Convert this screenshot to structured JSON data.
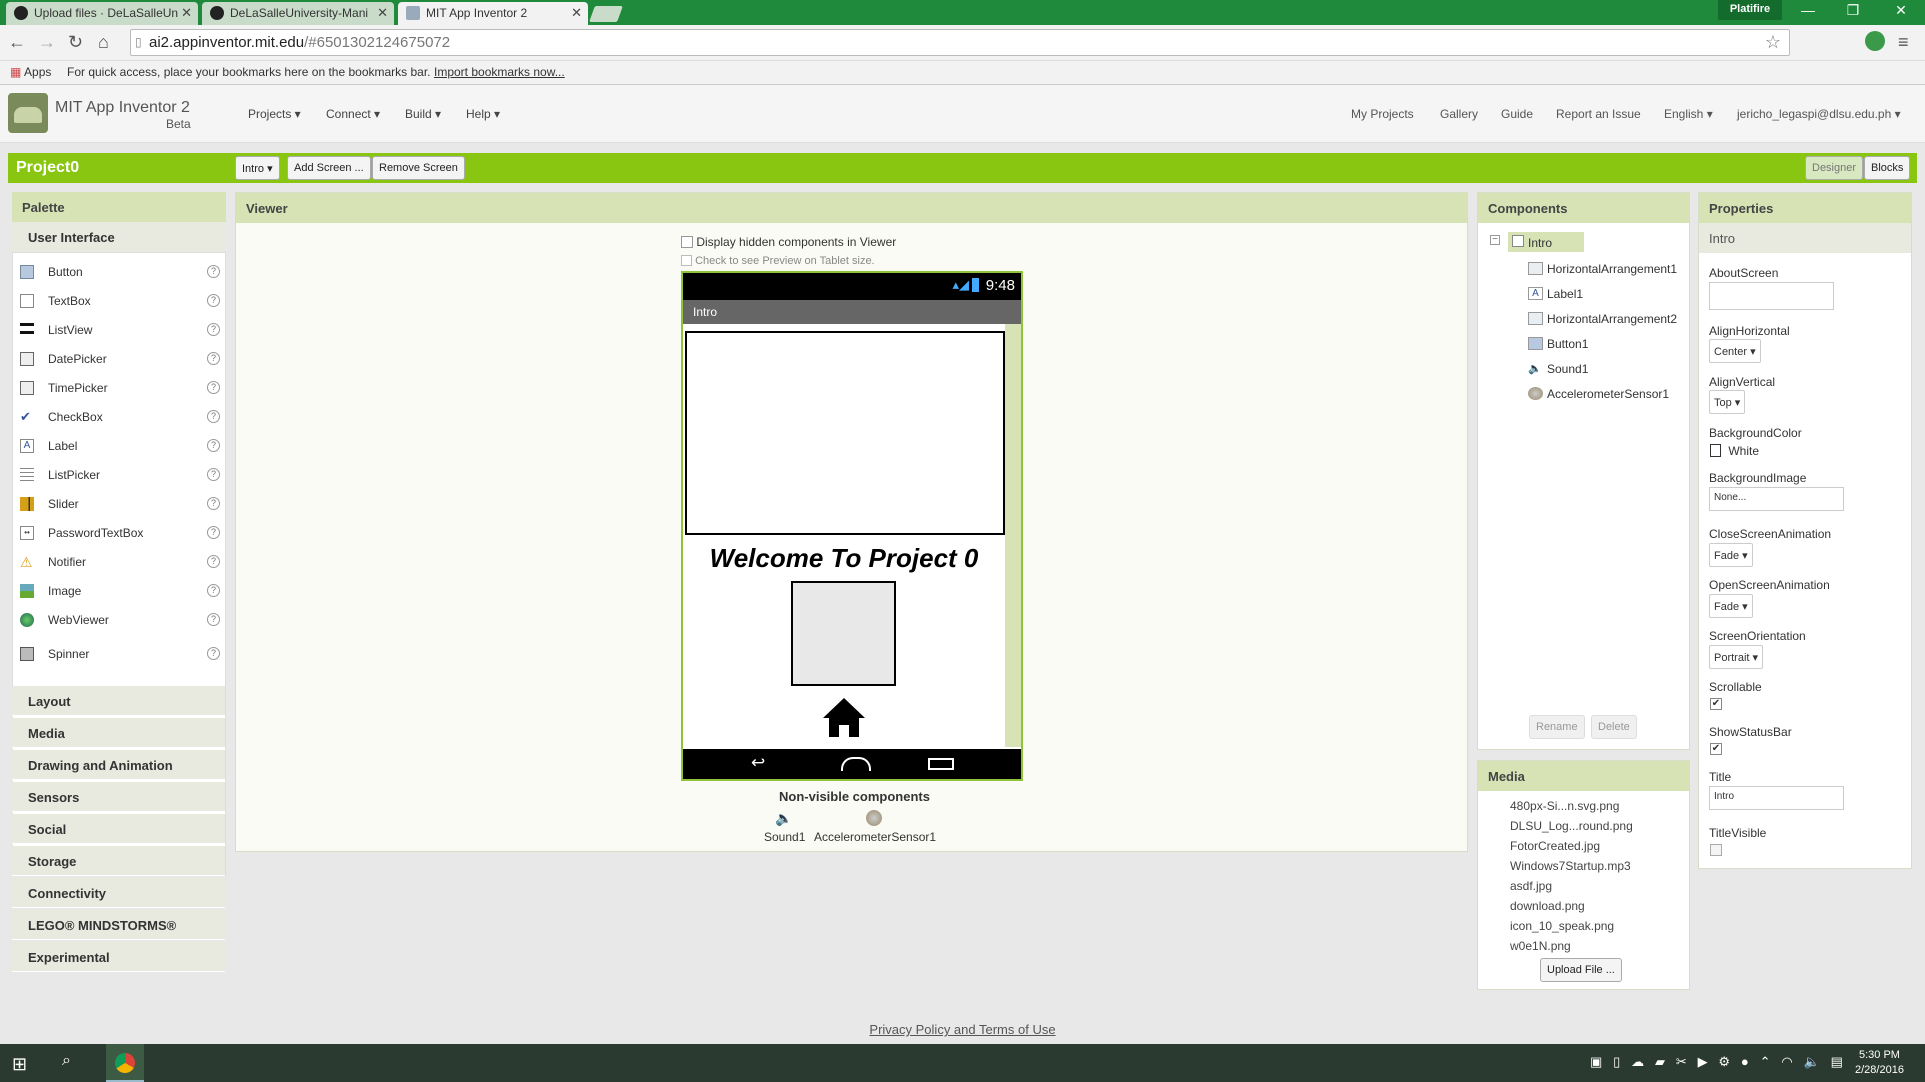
{
  "browser": {
    "tabs": [
      {
        "label": "Upload files · DeLaSalleUn",
        "active": false
      },
      {
        "label": "DeLaSalleUniversity-Mani",
        "active": false
      },
      {
        "label": "MIT App Inventor 2",
        "active": true
      }
    ],
    "profile": "Platifire",
    "url_host": "ai2.appinventor.mit.edu",
    "url_path": "/#6501302124675072",
    "bookmarks_apps": "Apps",
    "bookmarks_msg": "For quick access, place your bookmarks here on the bookmarks bar.",
    "bookmarks_import": "Import bookmarks now..."
  },
  "header": {
    "app_name": "MIT App Inventor 2",
    "beta": "Beta",
    "menus": [
      "Projects ▾",
      "Connect ▾",
      "Build ▾",
      "Help ▾"
    ],
    "links": [
      "My Projects",
      "Gallery",
      "Guide",
      "Report an Issue",
      "English ▾",
      "jericho_legaspi@dlsu.edu.ph ▾"
    ]
  },
  "toolbar": {
    "project": "Project0",
    "screen_select": "Intro ▾",
    "add_screen": "Add Screen ...",
    "remove_screen": "Remove Screen",
    "designer": "Designer",
    "blocks": "Blocks"
  },
  "palette": {
    "title": "Palette",
    "category": "User Interface",
    "items": [
      "Button",
      "TextBox",
      "ListView",
      "DatePicker",
      "TimePicker",
      "CheckBox",
      "Label",
      "ListPicker",
      "Slider",
      "PasswordTextBox",
      "Notifier",
      "Image",
      "WebViewer",
      "Spinner"
    ],
    "help": "?",
    "categories": [
      "Layout",
      "Media",
      "Drawing and Animation",
      "Sensors",
      "Social",
      "Storage",
      "Connectivity",
      "LEGO® MINDSTORMS®",
      "Experimental"
    ]
  },
  "viewer": {
    "title": "Viewer",
    "hidden_toggle": "Display hidden components in Viewer",
    "tablet_toggle": "Check to see Preview on Tablet size.",
    "clock": "9:48",
    "screen_title": "Intro",
    "welcome": "Welcome To Project 0",
    "nonvisible_title": "Non-visible components",
    "nonvisible": [
      "Sound1",
      "AccelerometerSensor1"
    ]
  },
  "components": {
    "title": "Components",
    "root": "Intro",
    "items": [
      "HorizontalArrangement1",
      "Label1",
      "HorizontalArrangement2",
      "Button1",
      "Sound1",
      "AccelerometerSensor1"
    ],
    "rename": "Rename",
    "delete": "Delete"
  },
  "media": {
    "title": "Media",
    "files": [
      "480px-Si...n.svg.png",
      "DLSU_Log...round.png",
      "FotorCreated.jpg",
      "Windows7Startup.mp3",
      "asdf.jpg",
      "download.png",
      "icon_10_speak.png",
      "w0e1N.png"
    ],
    "upload": "Upload File ..."
  },
  "properties": {
    "title": "Properties",
    "component": "Intro",
    "about_label": "AboutScreen",
    "about_value": "",
    "align_h_label": "AlignHorizontal",
    "align_h_value": "Center ▾",
    "align_v_label": "AlignVertical",
    "align_v_value": "Top ▾",
    "bg_color_label": "BackgroundColor",
    "bg_color_value": "White",
    "bg_image_label": "BackgroundImage",
    "bg_image_value": "None...",
    "close_anim_label": "CloseScreenAnimation",
    "close_anim_value": "Fade ▾",
    "open_anim_label": "OpenScreenAnimation",
    "open_anim_value": "Fade ▾",
    "orientation_label": "ScreenOrientation",
    "orientation_value": "Portrait ▾",
    "scrollable_label": "Scrollable",
    "scrollable": true,
    "statusbar_label": "ShowStatusBar",
    "statusbar": true,
    "title_label": "Title",
    "title_value": "Intro",
    "titlevisible_label": "TitleVisible",
    "titlevisible": false
  },
  "footer": "Privacy Policy and Terms of Use",
  "taskbar": {
    "time": "5:30 PM",
    "date": "2/28/2016"
  },
  "colors": {
    "accent": "#89c611",
    "panel_header": "#d7e3b5",
    "chrome_green": "#1f8a3c"
  }
}
